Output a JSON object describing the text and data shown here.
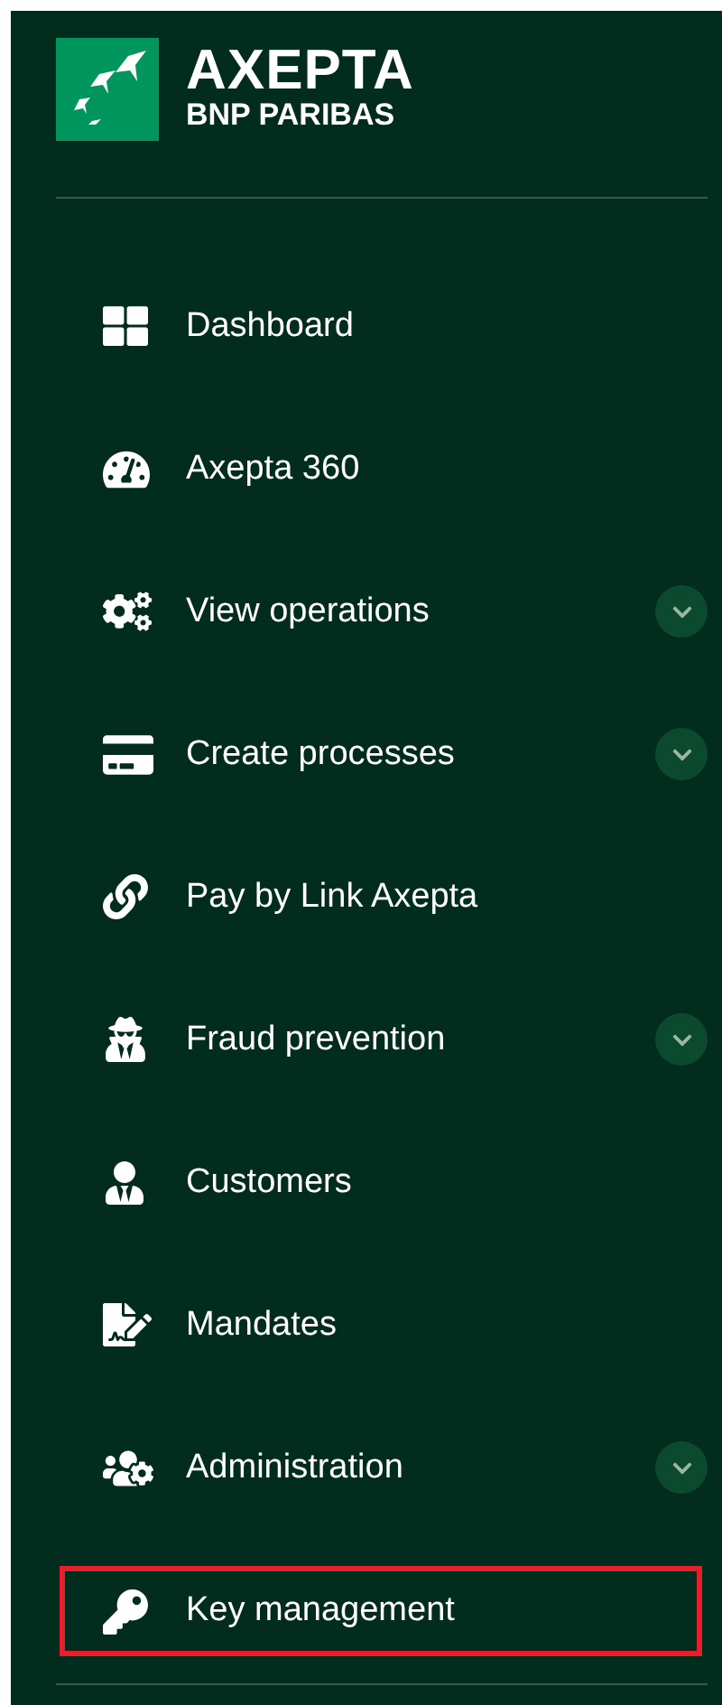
{
  "logo": {
    "name": "AXEPTA",
    "subtitle": "BNP PARIBAS"
  },
  "menu": [
    {
      "label": "Dashboard",
      "expandable": false,
      "highlighted": false
    },
    {
      "label": "Axepta 360",
      "expandable": false,
      "highlighted": false
    },
    {
      "label": "View operations",
      "expandable": true,
      "highlighted": false
    },
    {
      "label": "Create processes",
      "expandable": true,
      "highlighted": false
    },
    {
      "label": "Pay by Link Axepta",
      "expandable": false,
      "highlighted": false
    },
    {
      "label": "Fraud prevention",
      "expandable": true,
      "highlighted": false
    },
    {
      "label": "Customers",
      "expandable": false,
      "highlighted": false
    },
    {
      "label": "Mandates",
      "expandable": false,
      "highlighted": false
    },
    {
      "label": "Administration",
      "expandable": true,
      "highlighted": false
    },
    {
      "label": "Key management",
      "expandable": false,
      "highlighted": true
    }
  ]
}
